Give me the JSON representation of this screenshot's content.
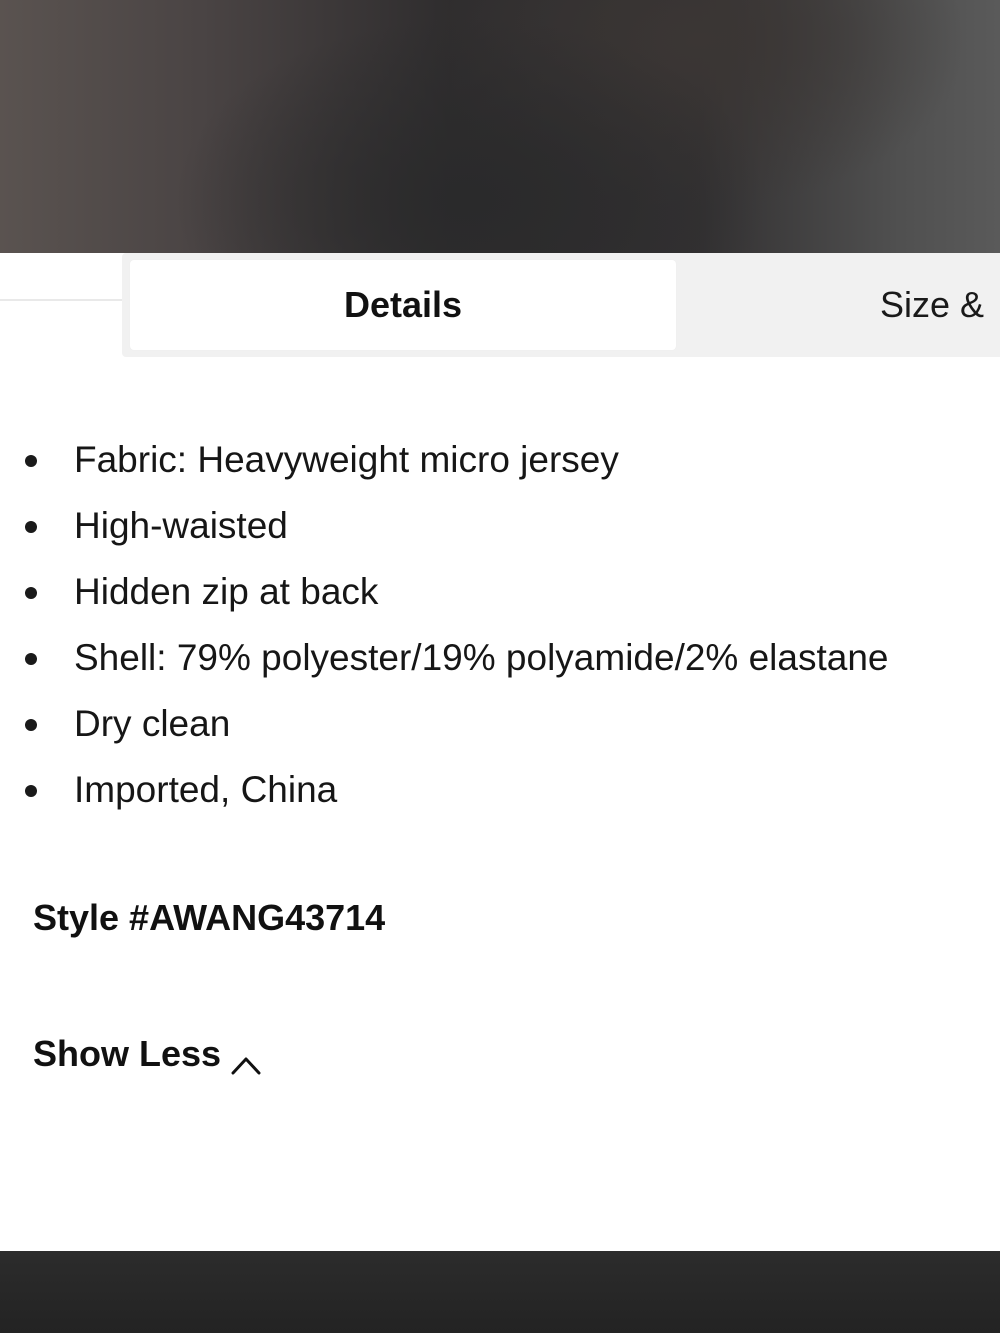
{
  "tabs": {
    "active_label": "Details",
    "next_label": "Size &"
  },
  "details": {
    "items": [
      "Fabric: Heavyweight micro jersey",
      "High-waisted",
      "Hidden zip at back",
      "Shell: 79% polyester/19% polyamide/2% elastane",
      "Dry clean",
      "Imported, China"
    ],
    "style_number": "Style #AWANG43714",
    "toggle_label": "Show Less",
    "toggle_icon": "chevron-up-icon"
  },
  "colors": {
    "text": "#141414",
    "tab_track": "#f1f1f1",
    "tab_active_bg": "#ffffff"
  }
}
